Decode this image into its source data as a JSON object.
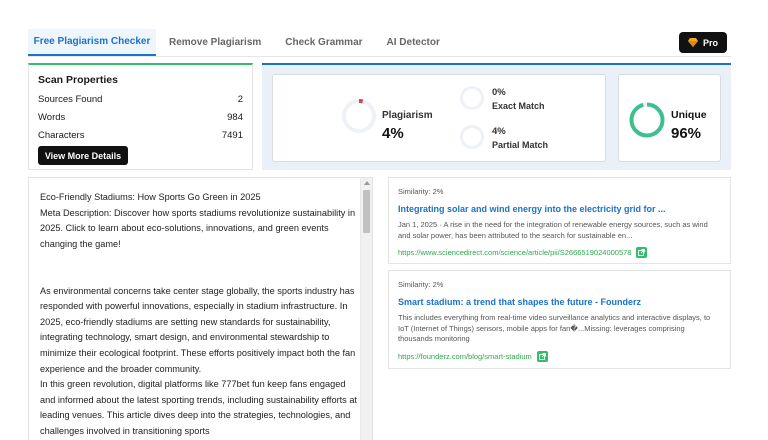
{
  "tabs": [
    {
      "label": "Free Plagiarism Checker",
      "active": true
    },
    {
      "label": "Remove Plagiarism",
      "active": false
    },
    {
      "label": "Check Grammar",
      "active": false
    },
    {
      "label": "AI Detector",
      "active": false
    }
  ],
  "pro": {
    "label": "Pro",
    "icon": "gem-icon",
    "icon_color": "#f5a623"
  },
  "scan_properties": {
    "title": "Scan Properties",
    "items": [
      {
        "label": "Sources Found",
        "value": "2"
      },
      {
        "label": "Words",
        "value": "984"
      },
      {
        "label": "Characters",
        "value": "7491"
      }
    ],
    "details_button": "View More Details"
  },
  "results": {
    "plagiarism": {
      "label": "Plagiarism",
      "value": "4%",
      "fraction": 0.04,
      "color": "#e04545"
    },
    "exact_match": {
      "label": "Exact Match",
      "value": "0%",
      "fraction": 0.0
    },
    "partial_match": {
      "label": "Partial Match",
      "value": "4%",
      "fraction": 0.04
    },
    "unique": {
      "label": "Unique",
      "value": "96%",
      "fraction": 0.96,
      "color": "#3fbf8f"
    }
  },
  "editor": {
    "paragraphs": [
      "Eco-Friendly Stadiums: How Sports Go Green in 2025",
      "Meta Description: Discover how sports stadiums revolutionize sustainability in 2025. Click to learn about eco-solutions, innovations, and green events changing the game!",
      "",
      "As environmental concerns take center stage globally, the sports industry has responded with powerful innovations, especially in stadium infrastructure. In 2025, eco-friendly stadiums are setting new standards for sustainability, integrating technology, smart design, and environmental stewardship to minimize their ecological footprint. These efforts positively impact both the fan experience and the broader community.",
      "In this green revolution, digital platforms like 777bet fun keep fans engaged and informed about the latest sporting trends, including sustainability efforts at leading venues. This article dives deep into the strategies, technologies, and challenges involved in transitioning sports"
    ]
  },
  "sources": [
    {
      "similarity": "Similarity: 2%",
      "title": "Integrating solar and wind energy into the electricity grid for ...",
      "description": "Jan 1, 2025 · A rise in the need for the integration of renewable energy sources, such as wind and solar power, has been attributed to the search for sustainable en...",
      "url": "https://www.sciencedirect.com/science/article/pii/S2666519024000578"
    },
    {
      "similarity": "Similarity: 2%",
      "title": "Smart stadium: a trend that shapes the future - Founderz",
      "description": "This includes everything from real-time video surveillance analytics and interactive displays, to IoT (Internet of Things) sensors, mobile apps for fan�...Missing: leverages comprising thousands monitoring",
      "url": "https://founderz.com/blog/smart-stadium"
    }
  ]
}
